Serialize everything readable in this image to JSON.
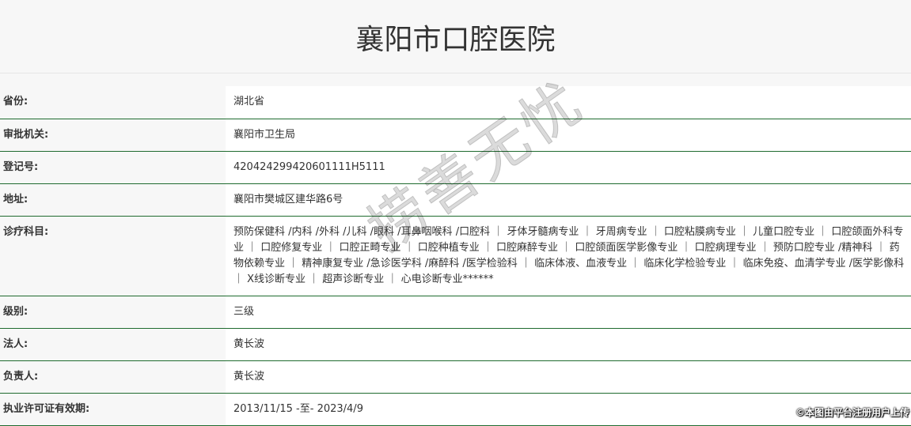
{
  "header": {
    "title": "襄阳市口腔医院"
  },
  "rows": [
    {
      "label": "省份:",
      "value": "湖北省"
    },
    {
      "label": "审批机关:",
      "value": "襄阳市卫生局"
    },
    {
      "label": "登记号:",
      "value": "420424299420601111H5111"
    },
    {
      "label": "地址:",
      "value": "襄阳市樊城区建华路6号"
    },
    {
      "label": "诊疗科目:",
      "value": "预防保健科 /内科 /外科 /儿科 /眼科 /耳鼻咽喉科 /口腔科 ｜ 牙体牙髓病专业 ｜ 牙周病专业 ｜ 口腔粘膜病专业 ｜ 儿童口腔专业 ｜ 口腔颌面外科专业 ｜ 口腔修复专业 ｜ 口腔正畸专业 ｜ 口腔种植专业 ｜ 口腔麻醉专业 ｜ 口腔颌面医学影像专业 ｜ 口腔病理专业 ｜ 预防口腔专业 /精神科 ｜ 药物依赖专业 ｜ 精神康复专业 /急诊医学科 /麻醉科 /医学检验科 ｜ 临床体液、血液专业 ｜ 临床化学检验专业 ｜ 临床免疫、血清学专业 /医学影像科 ｜ X线诊断专业 ｜ 超声诊断专业 ｜ 心电诊断专业******"
    },
    {
      "label": "级别:",
      "value": "三级"
    },
    {
      "label": "法人:",
      "value": "黄长波"
    },
    {
      "label": "负责人:",
      "value": "黄长波"
    },
    {
      "label": "执业许可证有效期:",
      "value": "2013/11/15 -至- 2023/4/9"
    }
  ],
  "watermark": {
    "text": "捞善无忧"
  },
  "credit": {
    "text": "©本图由平台注册用户上传"
  }
}
